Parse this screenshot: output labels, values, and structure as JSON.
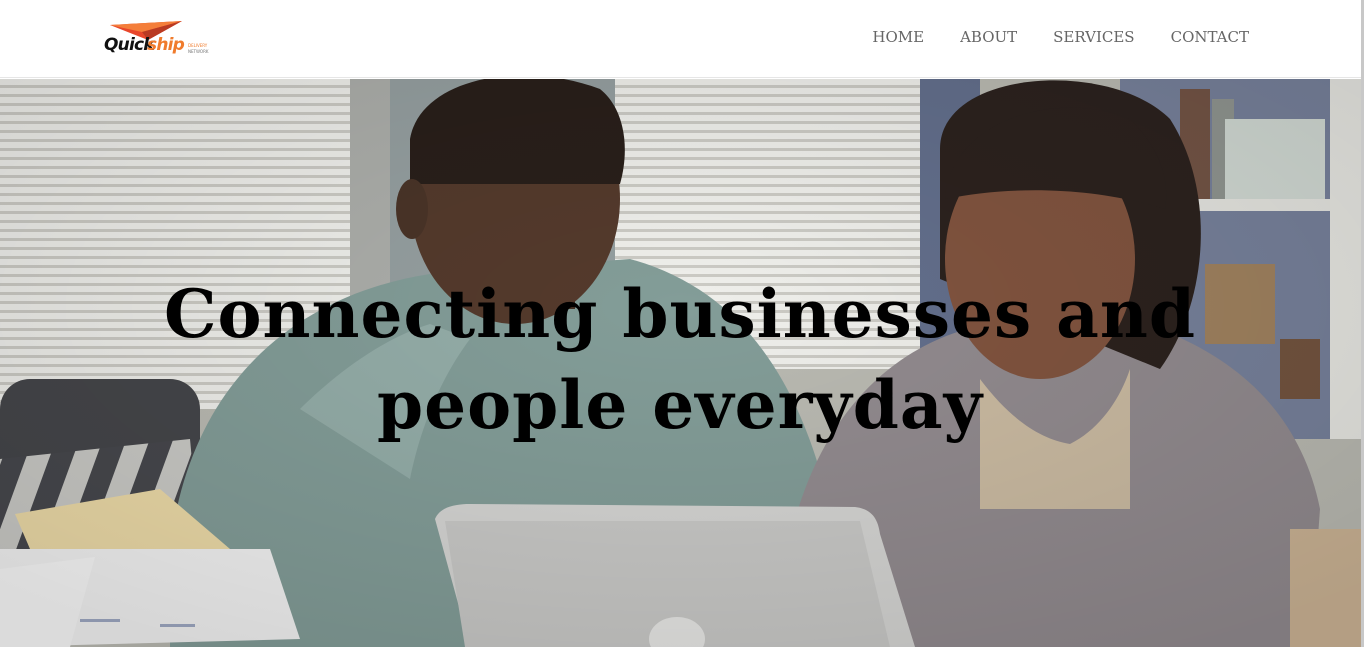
{
  "brand": {
    "name_part1": "Quick",
    "name_part2": "ship",
    "tagline_line1": "Delivery",
    "tagline_line2": "Network",
    "accent_color": "#f07b2c"
  },
  "nav": {
    "items": [
      {
        "label": "HOME"
      },
      {
        "label": "ABOUT"
      },
      {
        "label": "SERVICES"
      },
      {
        "label": "CONTACT"
      }
    ]
  },
  "hero": {
    "title": "Connecting businesses and people everyday"
  },
  "icons": {
    "logo_mark": "paper-plane-icon"
  }
}
